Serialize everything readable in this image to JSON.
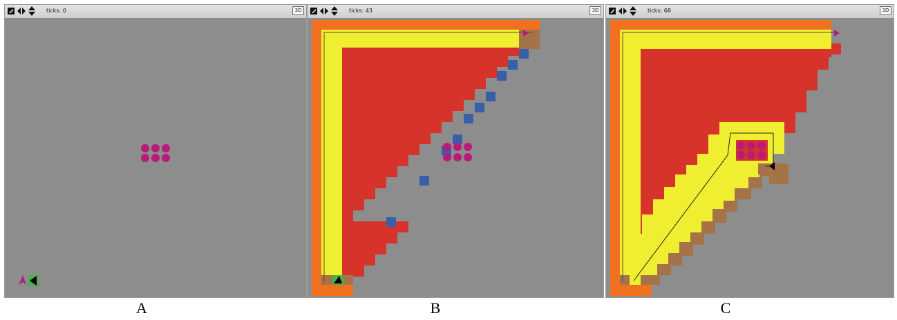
{
  "panels": [
    {
      "id": "A",
      "ticks_label": "ticks: 0",
      "view_3d_label": "3D",
      "caption": "A"
    },
    {
      "id": "B",
      "ticks_label": "ticks: 43",
      "view_3d_label": "3D",
      "caption": "B"
    },
    {
      "id": "C",
      "ticks_label": "ticks: 68",
      "view_3d_label": "3D",
      "caption": "C"
    }
  ],
  "toolbar_icons": [
    "edit-icon",
    "horizontal-arrows-icon",
    "vertical-arrows-icon"
  ],
  "colors": {
    "background": "#8d8d8d",
    "visited_border": "#f07020",
    "path_lane": "#f0ee30",
    "explored_area": "#d6332b",
    "frontier": "#3a5faa",
    "trail": "#a47448",
    "food": "#b81c78",
    "agent_magenta": "#b01c80",
    "agent_black": "#000000",
    "home_patch": "#4caf50"
  }
}
